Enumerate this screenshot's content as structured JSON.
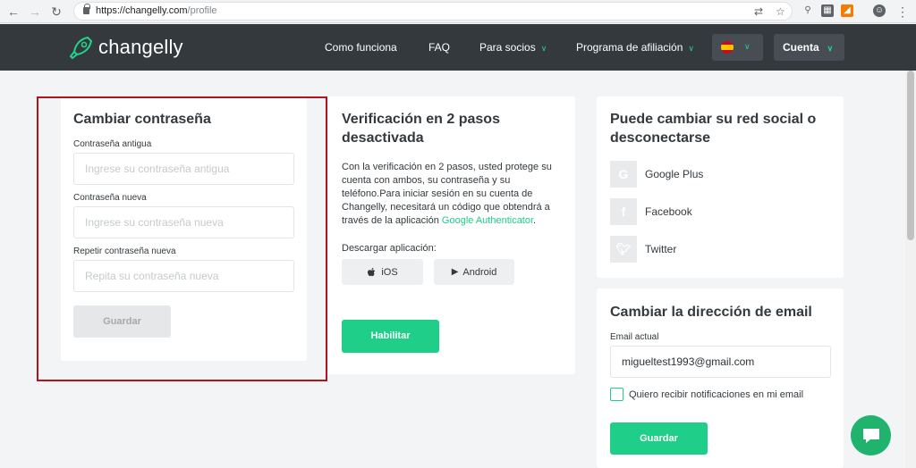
{
  "browser": {
    "url_host": "https://changelly.com",
    "url_path": "/profile"
  },
  "header": {
    "logo_text": "changelly",
    "nav": [
      "Como funciona",
      "FAQ",
      "Para socios",
      "Programa de afiliación"
    ],
    "account_label": "Cuenta"
  },
  "password_card": {
    "title": "Cambiar contraseña",
    "old_label": "Contraseña antigua",
    "old_placeholder": "Ingrese su contraseña antigua",
    "new_label": "Contraseña nueva",
    "new_placeholder": "Ingrese su contraseña nueva",
    "repeat_label": "Repetir contraseña nueva",
    "repeat_placeholder": "Repita su contraseña nueva",
    "save_label": "Guardar"
  },
  "twofa_card": {
    "title": "Verificación en 2 pasos desactivada",
    "description": "Con la verificación en 2 pasos, usted protege su cuenta con ambos, su contraseña y su teléfono.Para iniciar sesión en su cuenta de Changelly, necesitará un código que obtendrá a través de la aplicación",
    "app_link": "Google Authenticator",
    "download_label": "Descargar aplicación:",
    "ios_label": "iOS",
    "android_label": "Android",
    "enable_label": "Habilitar"
  },
  "social_card": {
    "title": "Puede cambiar su red social o desconectarse",
    "items": [
      "Google Plus",
      "Facebook",
      "Twitter"
    ]
  },
  "email_card": {
    "title": "Cambiar la dirección de email",
    "current_label": "Email actual",
    "current_value": "migueltest1993@gmail.com",
    "notify_label": "Quiero recibir notificaciones en mi email",
    "save_label": "Guardar"
  },
  "colors": {
    "accent": "#1fce88",
    "header_bg": "#33393d",
    "highlight_outline": "#b0141c"
  }
}
